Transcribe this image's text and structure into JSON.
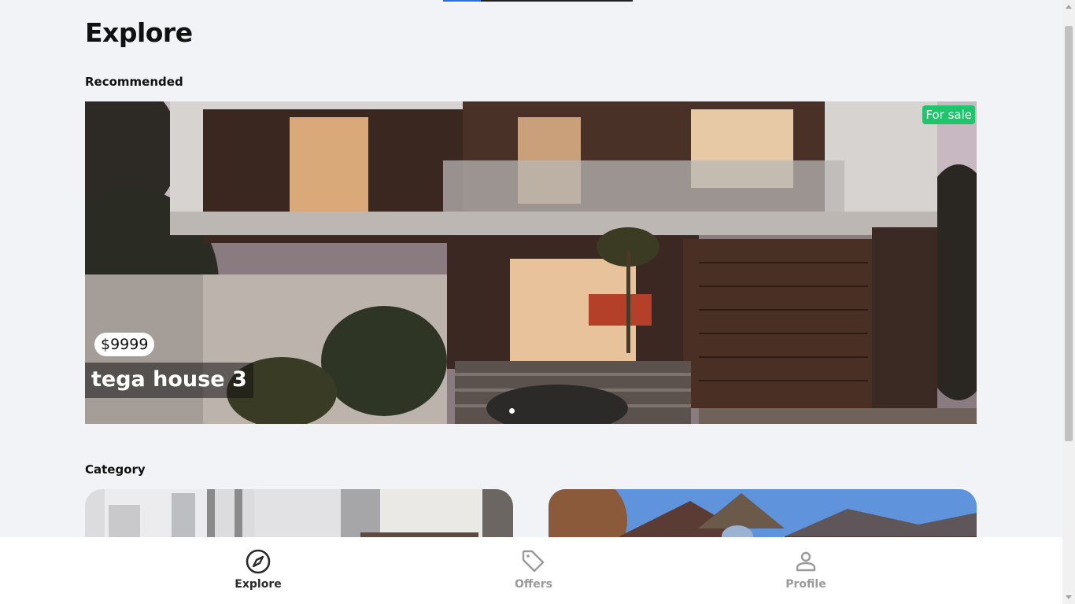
{
  "page": {
    "title": "Explore",
    "sections": {
      "recommended": "Recommended",
      "category": "Category"
    }
  },
  "hero": {
    "badge": "For sale",
    "price": "$9999",
    "name": "tega house 3",
    "carousel_dots": 1,
    "active_dot": 1
  },
  "nav": {
    "items": [
      {
        "label": "Explore",
        "icon": "compass-icon",
        "active": true
      },
      {
        "label": "Offers",
        "icon": "tag-icon",
        "active": false
      },
      {
        "label": "Profile",
        "icon": "person-icon",
        "active": false
      }
    ]
  },
  "colors": {
    "background": "#f2f3f7",
    "badge_green": "#1fc46b",
    "nav_active": "#2b2b2b",
    "nav_inactive": "#9a9a9a"
  }
}
